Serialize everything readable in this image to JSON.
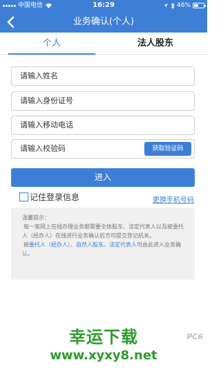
{
  "status_bar": {
    "carrier": "中国电信",
    "time": "16:29",
    "battery": "46%",
    "battery_level": 0.46
  },
  "nav": {
    "title": "业务确认(个人)"
  },
  "tabs": [
    {
      "label": "个人",
      "active": true
    },
    {
      "label": "法人股东",
      "active": false
    }
  ],
  "form": {
    "name_placeholder": "请输入姓名",
    "id_placeholder": "请输入身份证号",
    "phone_placeholder": "请输入移动电话",
    "code_placeholder": "请输入校验码",
    "get_code_label": "获取验证码",
    "submit_label": "进入",
    "remember_label": "记住登录信息",
    "change_phone_label": "更换手机号码"
  },
  "tips": {
    "title": "温馨提示：",
    "line1": "每一笔网上在线办理业务都需要全体股东、法定代表人以及被委托人（经办人）在线进行业务确认后方可提交登记机关。",
    "line2_prefix": "被",
    "line2_highlight": "委托人（经办人）、自然人股东、法定代表人",
    "line2_suffix": "可由此进入业务确认。"
  },
  "watermark": {
    "title": "幸运下载",
    "url": "www.xyxy8.net",
    "badge": "PC6"
  },
  "colors": {
    "accent": "#3d7fd6",
    "watermark": "#2e9a2e"
  }
}
